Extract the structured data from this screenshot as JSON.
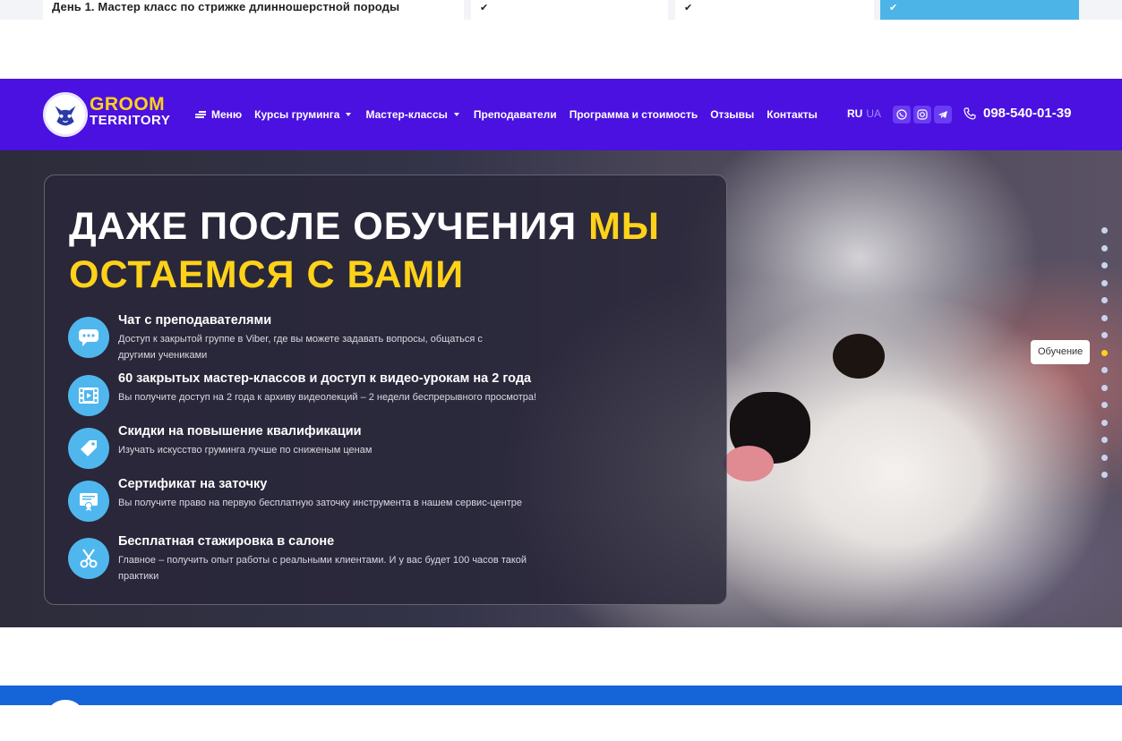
{
  "top_row": {
    "text": "День 1. Мастер класс по стрижке длинношерстной породы",
    "check1": "✔",
    "check2": "✔",
    "check3": "✔"
  },
  "header": {
    "brand_line1": "GROOM",
    "brand_line2": "TERRITORY",
    "nav": {
      "menu": "Меню",
      "courses": "Курсы груминга",
      "masterclasses": "Мастер-классы",
      "teachers": "Преподаватели",
      "program": "Программа и стоимость",
      "reviews": "Отзывы",
      "contacts": "Контакты"
    },
    "lang_active": "RU",
    "lang_other": "UA",
    "phone": "098-540-01-39"
  },
  "hero": {
    "title_white": "Даже после обучения ",
    "title_yellow1": "мы",
    "title_yellow2": "остаемся с вами",
    "features": [
      {
        "title": "Чат с преподавателями",
        "desc": "Доступ к закрытой группе в Viber, где вы можете задавать вопросы, общаться с другими учениками",
        "icon": "chat-icon"
      },
      {
        "title": "60 закрытых мастер-классов и доступ к видео-урокам на 2 года",
        "desc": "Вы получите доступ на 2 года к архиву видеолекций – 2 недели беспрерывного просмотра!",
        "icon": "film-icon"
      },
      {
        "title": "Скидки на повышение квалификации",
        "desc": "Изучать искусство груминга лучше по сниженым ценам",
        "icon": "tag-icon"
      },
      {
        "title": "Сертификат на заточку",
        "desc": "Вы получите право на первую бесплатную заточку инструмента в нашем сервис-центре",
        "icon": "certificate-icon"
      },
      {
        "title": "Бесплатная стажировка в салоне",
        "desc": "Главное – получить опыт работы с реальными клиентами. И у вас будет 100 часов такой практики",
        "icon": "scissors-icon"
      }
    ],
    "tooltip": "Обучение"
  },
  "colors": {
    "header_bg": "#4a11e0",
    "accent_yellow": "#ffd21a",
    "icon_blue": "#4fb7ee",
    "bottom_bar": "#1565d8"
  }
}
